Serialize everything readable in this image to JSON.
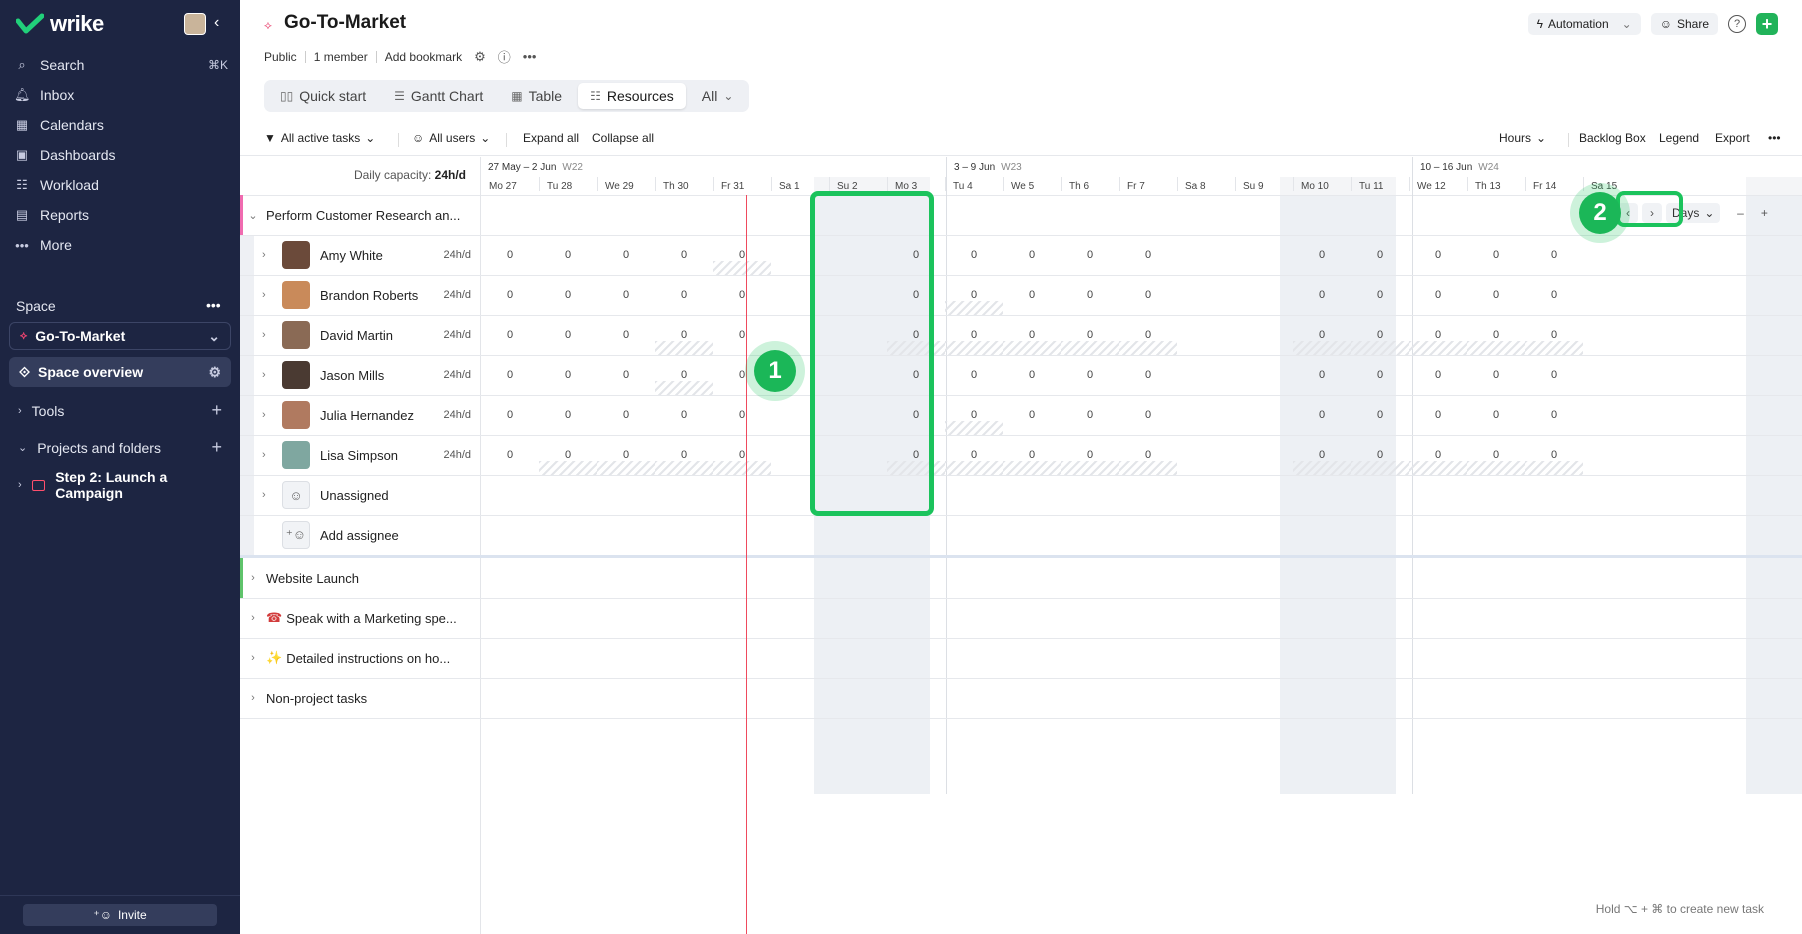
{
  "sidebar": {
    "brand": "wrike",
    "nav": [
      {
        "icon": "search-icon",
        "glyph": "⌕",
        "label": "Search",
        "shortcut": "⌘K"
      },
      {
        "icon": "bell-icon",
        "glyph": "♫",
        "label": "Inbox"
      },
      {
        "icon": "calendar-icon",
        "glyph": "▦",
        "label": "Calendars"
      },
      {
        "icon": "dashboard-icon",
        "glyph": "▣",
        "label": "Dashboards"
      },
      {
        "icon": "workload-icon",
        "glyph": "☷",
        "label": "Workload"
      },
      {
        "icon": "report-icon",
        "glyph": "▤",
        "label": "Reports"
      },
      {
        "icon": "more-icon",
        "glyph": "•••",
        "label": "More"
      }
    ],
    "space_label": "Space",
    "space_name": "Go-To-Market",
    "space_overview": "Space overview",
    "tools": "Tools",
    "projects_and_folders": "Projects and folders",
    "project_item": "Step 2: Launch a Campaign",
    "invite": "Invite"
  },
  "header": {
    "title": "Go-To-Market",
    "meta": [
      "Public",
      "1 member",
      "Add bookmark"
    ],
    "automation": "Automation",
    "share": "Share",
    "help": "?",
    "add": "+"
  },
  "tabs": [
    {
      "icon": "quick-start-icon",
      "glyph": "▯▯",
      "label": "Quick start"
    },
    {
      "icon": "gantt-icon",
      "glyph": "☰",
      "label": "Gantt Chart"
    },
    {
      "icon": "table-icon",
      "glyph": "▦",
      "label": "Table"
    },
    {
      "icon": "resources-icon",
      "glyph": "☷",
      "label": "Resources",
      "active": true
    },
    {
      "label": "All",
      "dropdown": true
    }
  ],
  "toolbar": {
    "filter_tasks": "All active tasks",
    "filter_users": "All users",
    "expand_all": "Expand all",
    "collapse_all": "Collapse all",
    "units": "Hours",
    "backlog_box": "Backlog Box",
    "legend": "Legend",
    "export": "Export"
  },
  "grid": {
    "daily_capacity_label": "Daily capacity:",
    "daily_capacity_value": "24h/d",
    "weeks": [
      {
        "range": "27 May – 2 Jun",
        "week": "W22"
      },
      {
        "range": "3 – 9 Jun",
        "week": "W23"
      },
      {
        "range": "10 – 16 Jun",
        "week": "W24"
      }
    ],
    "days": [
      "Mo 27",
      "Tu 28",
      "We 29",
      "Th 30",
      "Fr 31",
      "Sa 1",
      "Su 2",
      "Mo 3",
      "Tu 4",
      "We 5",
      "Th 6",
      "Fr 7",
      "Sa 8",
      "Su 9",
      "Mo 10",
      "Tu 11",
      "We 12",
      "Th 13",
      "Fr 14",
      "Sa 15"
    ],
    "zoom": "Days",
    "group_task": "Perform Customer Research an...",
    "people": [
      {
        "name": "Amy White",
        "capacity": "24h/d",
        "values": [
          "0",
          "0",
          "0",
          "0",
          "0",
          "0",
          "0",
          "0",
          "0",
          "0",
          "0",
          "0",
          "0",
          "0",
          "0"
        ]
      },
      {
        "name": "Brandon Roberts",
        "capacity": "24h/d",
        "values": [
          "0",
          "0",
          "0",
          "0",
          "0",
          "0",
          "0",
          "0",
          "0",
          "0",
          "0",
          "0",
          "0",
          "0",
          "0"
        ]
      },
      {
        "name": "David Martin",
        "capacity": "24h/d",
        "values": [
          "0",
          "0",
          "0",
          "0",
          "0",
          "0",
          "0",
          "0",
          "0",
          "0",
          "0",
          "0",
          "0",
          "0",
          "0"
        ]
      },
      {
        "name": "Jason Mills",
        "capacity": "24h/d",
        "values": [
          "0",
          "0",
          "0",
          "0",
          "0",
          "0",
          "0",
          "0",
          "0",
          "0",
          "0",
          "0",
          "0",
          "0",
          "0"
        ]
      },
      {
        "name": "Julia Hernandez",
        "capacity": "24h/d",
        "values": [
          "0",
          "0",
          "0",
          "0",
          "0",
          "0",
          "0",
          "0",
          "0",
          "0",
          "0",
          "0",
          "0",
          "0",
          "0"
        ]
      },
      {
        "name": "Lisa Simpson",
        "capacity": "24h/d",
        "values": [
          "0",
          "0",
          "0",
          "0",
          "0",
          "0",
          "0",
          "0",
          "0",
          "0",
          "0",
          "0",
          "0",
          "0",
          "0"
        ]
      }
    ],
    "unassigned": "Unassigned",
    "add_assignee": "Add assignee",
    "other_groups": [
      {
        "label": "Website Launch",
        "prefix": ""
      },
      {
        "label": "Speak with a Marketing spe...",
        "prefix": "☎"
      },
      {
        "label": "Detailed instructions on ho...",
        "prefix": "✨"
      },
      {
        "label": "Non-project tasks",
        "prefix": ""
      }
    ],
    "hint": "Hold ⌥ + ⌘ to create new task"
  },
  "annotations": {
    "badge1": "1",
    "badge2": "2"
  },
  "colors": {
    "sidebar": "#1d2542",
    "accent_green": "#1bc35c",
    "today_line": "#ef4a5d",
    "brand_green": "#21b35a"
  }
}
